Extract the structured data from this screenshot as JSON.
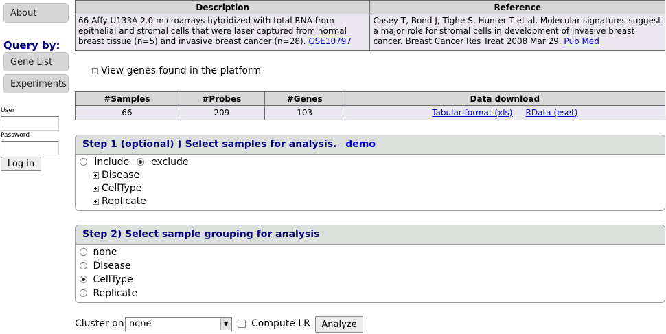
{
  "sidebar": {
    "about": "About",
    "query_by": "Query by:",
    "gene_list": "Gene List",
    "experiments": "Experiments",
    "user_label": "User",
    "password_label": "Password",
    "login_button": "Log in"
  },
  "description_table": {
    "headers": [
      "Description",
      "Reference"
    ],
    "description_text": "66 Affy U133A 2.0 microarrays hybridized with total RNA from epithelial and stromal cells that were laser captured from normal breast tissue (n=5) and invasive breast cancer (n=28).",
    "description_link": "GSE10797",
    "reference_text": "Casey T, Bond J, Tighe S, Hunter T et al. Molecular signatures suggest a major role for stromal cells in development of invasive breast cancer. Breast Cancer Res Treat 2008 Mar 29.",
    "reference_link": "Pub Med"
  },
  "view_genes": "View genes found in the platform",
  "stats_table": {
    "headers": [
      "#Samples",
      "#Probes",
      "#Genes",
      "Data download"
    ],
    "samples": "66",
    "probes": "209",
    "genes": "103",
    "download_xls": "Tabular format (xls)",
    "download_rdata": "RData (eset)"
  },
  "step1": {
    "title": "Step 1 (optional) ) Select samples for analysis.",
    "demo_link": "demo",
    "include_label": "include",
    "exclude_label": "exclude",
    "selected_mode": "exclude",
    "groups": [
      "Disease",
      "CellType",
      "Replicate"
    ]
  },
  "step2": {
    "title": "Step 2) Select sample grouping for analysis",
    "options": [
      "none",
      "Disease",
      "CellType",
      "Replicate"
    ],
    "selected": "CellType"
  },
  "bottom": {
    "cluster_label": "Cluster on",
    "cluster_value": "none",
    "compute_lr_label": "Compute LR",
    "compute_lr_checked": false,
    "analyze_button": "Analyze"
  }
}
